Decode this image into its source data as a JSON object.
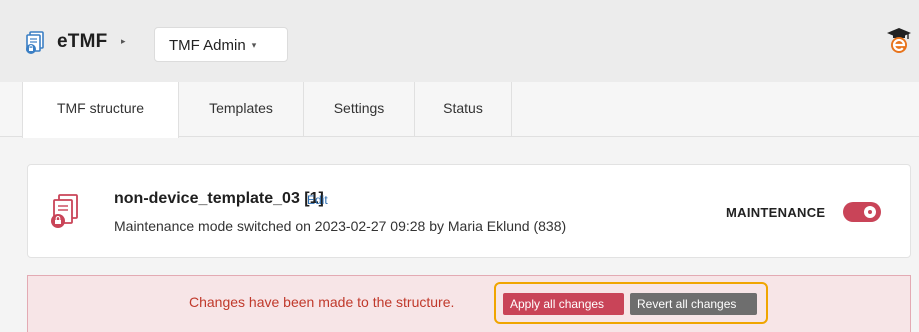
{
  "header": {
    "app_name": "eTMF",
    "breadcrumb_separator": "▸",
    "dropdown": {
      "selected": "TMF Admin",
      "caret": "▾"
    }
  },
  "tabs": [
    {
      "label": "TMF structure",
      "active": true
    },
    {
      "label": "Templates",
      "active": false
    },
    {
      "label": "Settings",
      "active": false
    },
    {
      "label": "Status",
      "active": false
    }
  ],
  "template": {
    "title": "non-device_template_03 [1]",
    "edit_label": "Edit",
    "subtitle": "Maintenance mode switched on 2023-02-27 09:28 by Maria Eklund (838)",
    "maintenance_label": "MAINTENANCE",
    "maintenance_on": true
  },
  "alert": {
    "message": "Changes have been made to the structure.",
    "apply_label": "Apply all changes",
    "revert_label": "Revert all changes"
  },
  "colors": {
    "accent": "#c94458",
    "alert_bg": "#f7e5e7",
    "alert_text": "#c0392b",
    "highlight": "#f0a500",
    "link": "#2b6cb0"
  },
  "icons": {
    "app": "document-stack-lock-icon",
    "user": "graduation-cap-user-icon",
    "template": "locked-documents-icon"
  }
}
